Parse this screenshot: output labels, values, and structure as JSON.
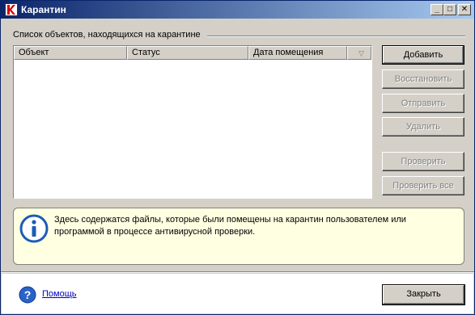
{
  "window": {
    "title": "Карантин",
    "controls": {
      "minimize": "_",
      "maximize": "□",
      "close": "✕"
    }
  },
  "group": {
    "label": "Список объектов, находящихся на карантине"
  },
  "list": {
    "columns": [
      "Объект",
      "Статус",
      "Дата помещения"
    ],
    "sort_indicator": "▽",
    "rows": []
  },
  "buttons": {
    "add": "Добавить",
    "restore": "Восстановить",
    "send": "Отправить",
    "delete": "Удалить",
    "scan": "Проверить",
    "scan_all": "Проверить все"
  },
  "info": {
    "text": "Здесь содержатся файлы, которые были помещены на карантин пользователем или программой в процессе антивирусной проверки."
  },
  "footer": {
    "help_link": "Помощь",
    "close_button": "Закрыть"
  },
  "colors": {
    "title_start": "#0a246a",
    "title_end": "#a6caf0",
    "face": "#d4d0c8",
    "info_bg": "#ffffe1",
    "info_icon": "#1c5bb8",
    "link": "#0000c0"
  }
}
